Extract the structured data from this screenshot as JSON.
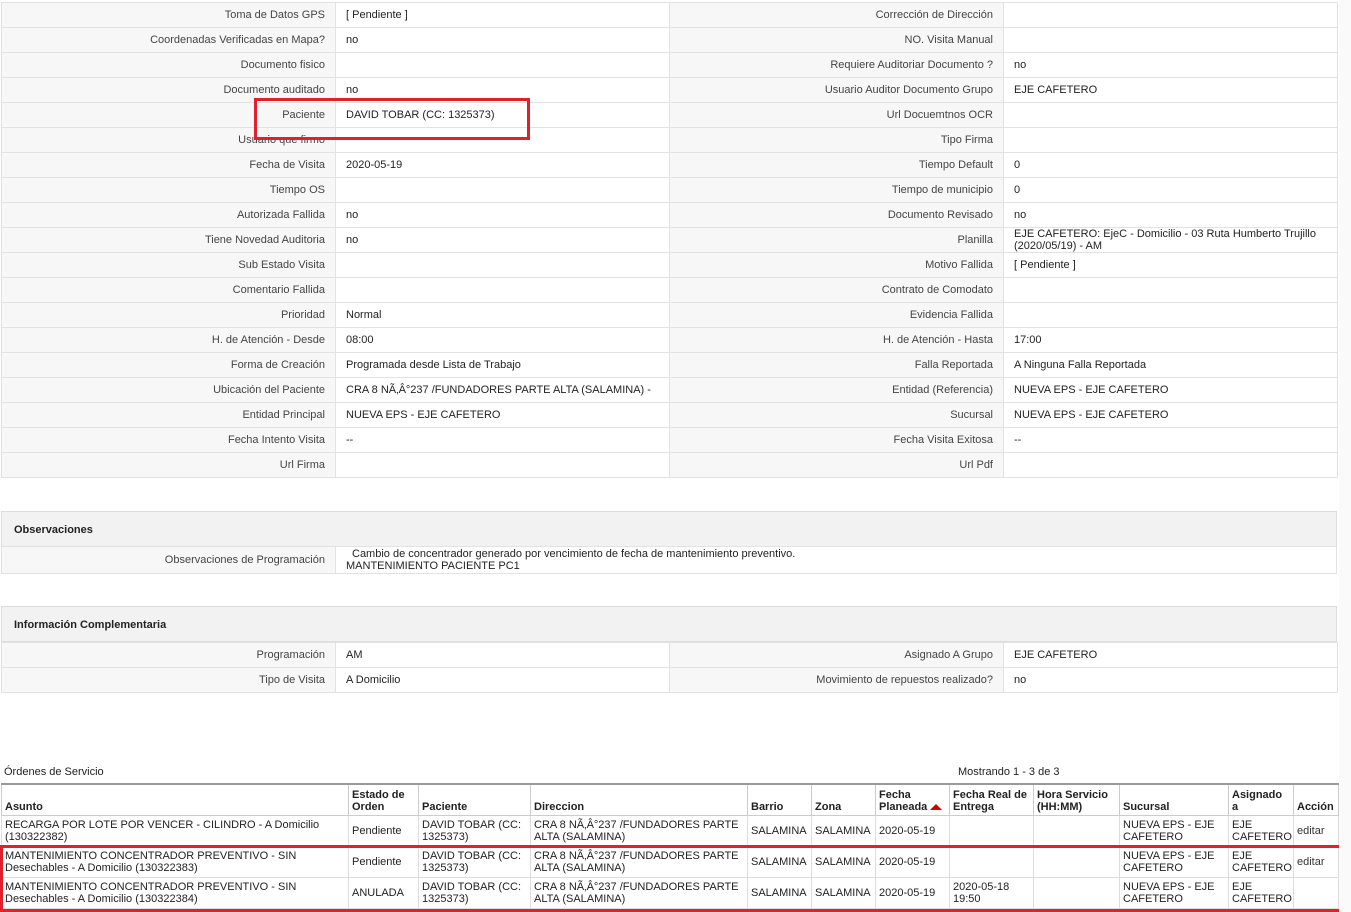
{
  "visit_details": {
    "rows": [
      {
        "l1": "Toma de Datos GPS",
        "v1": "[ Pendiente ]",
        "l2": "Corrección de Dirección",
        "v2": ""
      },
      {
        "l1": "Coordenadas Verificadas en Mapa?",
        "v1": "no",
        "l2": "NO. Visita Manual",
        "v2": ""
      },
      {
        "l1": "Documento fisico",
        "v1": "",
        "l2": "Requiere Auditoriar Documento ?",
        "v2": "no"
      },
      {
        "l1": "Documento auditado",
        "v1": "no",
        "l2": "Usuario Auditor Documento Grupo",
        "v2": "EJE CAFETERO"
      },
      {
        "l1": "Paciente",
        "v1": "DAVID TOBAR (CC: 1325373)",
        "l2": "Url Docuemtnos OCR",
        "v2": ""
      },
      {
        "l1": "Usuario que firmo",
        "v1": "",
        "l2": "Tipo Firma",
        "v2": ""
      },
      {
        "l1": "Fecha de Visita",
        "v1": "2020-05-19",
        "l2": "Tiempo Default",
        "v2": "0"
      },
      {
        "l1": "Tiempo OS",
        "v1": "",
        "l2": "Tiempo de municipio",
        "v2": "0"
      },
      {
        "l1": "Autorizada Fallida",
        "v1": "no",
        "l2": "Documento Revisado",
        "v2": "no"
      },
      {
        "l1": "Tiene Novedad Auditoria",
        "v1": "no",
        "l2": "Planilla",
        "v2": "EJE CAFETERO: EjeC - Domicilio - 03 Ruta Humberto Trujillo (2020/05/19) - AM"
      },
      {
        "l1": "Sub Estado Visita",
        "v1": "",
        "l2": "Motivo Fallida",
        "v2": "[ Pendiente ]"
      },
      {
        "l1": "Comentario Fallida",
        "v1": "",
        "l2": "Contrato de Comodato",
        "v2": ""
      },
      {
        "l1": "Prioridad",
        "v1": "Normal",
        "l2": "Evidencia Fallida",
        "v2": ""
      },
      {
        "l1": "H. de Atención - Desde",
        "v1": "08:00",
        "l2": "H. de Atención - Hasta",
        "v2": "17:00"
      },
      {
        "l1": "Forma de Creación",
        "v1": "Programada desde Lista de Trabajo",
        "l2": "Falla Reportada",
        "v2": "A Ninguna Falla Reportada"
      },
      {
        "l1": "Ubicación del Paciente",
        "v1": "CRA 8 NÃ‚Â°237 /FUNDADORES PARTE ALTA (SALAMINA) -",
        "l2": "Entidad (Referencia)",
        "v2": "NUEVA EPS - EJE CAFETERO"
      },
      {
        "l1": "Entidad Principal",
        "v1": "NUEVA EPS - EJE CAFETERO",
        "l2": "Sucursal",
        "v2": "NUEVA EPS - EJE CAFETERO"
      },
      {
        "l1": "Fecha Intento Visita",
        "v1": "--",
        "l2": "Fecha Visita Exitosa",
        "v2": "--"
      },
      {
        "l1": "Url Firma",
        "v1": "",
        "l2": "Url Pdf",
        "v2": ""
      }
    ]
  },
  "observaciones": {
    "title": "Observaciones",
    "label": "Observaciones de Programación",
    "line1": "Cambio de concentrador generado por vencimiento de fecha de mantenimiento preventivo.",
    "line2": "MANTENIMIENTO PACIENTE PC1"
  },
  "complementaria": {
    "title": "Información Complementaria",
    "rows": [
      {
        "l1": "Programación",
        "v1": "AM",
        "l2": "Asignado A Grupo",
        "v2": "EJE CAFETERO"
      },
      {
        "l1": "Tipo de Visita",
        "v1": "A Domicilio",
        "l2": "Movimiento de repuestos realizado?",
        "v2": "no"
      }
    ]
  },
  "ordenes": {
    "title": "Órdenes de Servicio",
    "count": "Mostrando 1 - 3 de 3",
    "headers": [
      "Asunto",
      "Estado de Orden",
      "Paciente",
      "Direccion",
      "Barrio",
      "Zona",
      "Fecha Planeada",
      "Fecha Real de Entrega",
      "Hora Servicio (HH:MM)",
      "Sucursal",
      "Asignado a",
      "Acción"
    ],
    "rows": [
      {
        "asunto": "RECARGA POR LOTE POR VENCER - CILINDRO - A Domicilio (130322382)",
        "estado": "Pendiente",
        "paciente": "DAVID TOBAR (CC: 1325373)",
        "direccion": "CRA 8 NÃ‚Â°237 /FUNDADORES PARTE ALTA (SALAMINA)",
        "barrio": "SALAMINA",
        "zona": "SALAMINA",
        "fecha_planeada": "2020-05-19",
        "fecha_real": "",
        "hora": "",
        "sucursal": "NUEVA EPS - EJE CAFETERO",
        "asignado": "EJE CAFETERO",
        "accion": "editar"
      },
      {
        "asunto": "MANTENIMIENTO CONCENTRADOR PREVENTIVO - SIN Desechables - A Domicilio (130322383)",
        "estado": "Pendiente",
        "paciente": "DAVID TOBAR (CC: 1325373)",
        "direccion": "CRA 8 NÃ‚Â°237 /FUNDADORES PARTE ALTA (SALAMINA)",
        "barrio": "SALAMINA",
        "zona": "SALAMINA",
        "fecha_planeada": "2020-05-19",
        "fecha_real": "",
        "hora": "",
        "sucursal": "NUEVA EPS - EJE CAFETERO",
        "asignado": "EJE CAFETERO",
        "accion": "editar"
      },
      {
        "asunto": "MANTENIMIENTO CONCENTRADOR PREVENTIVO - SIN Desechables - A Domicilio (130322384)",
        "estado": "ANULADA",
        "paciente": "DAVID TOBAR (CC: 1325373)",
        "direccion": "CRA 8 NÃ‚Â°237 /FUNDADORES PARTE ALTA (SALAMINA)",
        "barrio": "SALAMINA",
        "zona": "SALAMINA",
        "fecha_planeada": "2020-05-19",
        "fecha_real": "2020-05-18 19:50",
        "hora": "",
        "sucursal": "NUEVA EPS - EJE CAFETERO",
        "asignado": "EJE CAFETERO",
        "accion": ""
      }
    ]
  },
  "colors": {
    "highlight": "#e0202a",
    "sort_arrow": "#cc0000"
  }
}
